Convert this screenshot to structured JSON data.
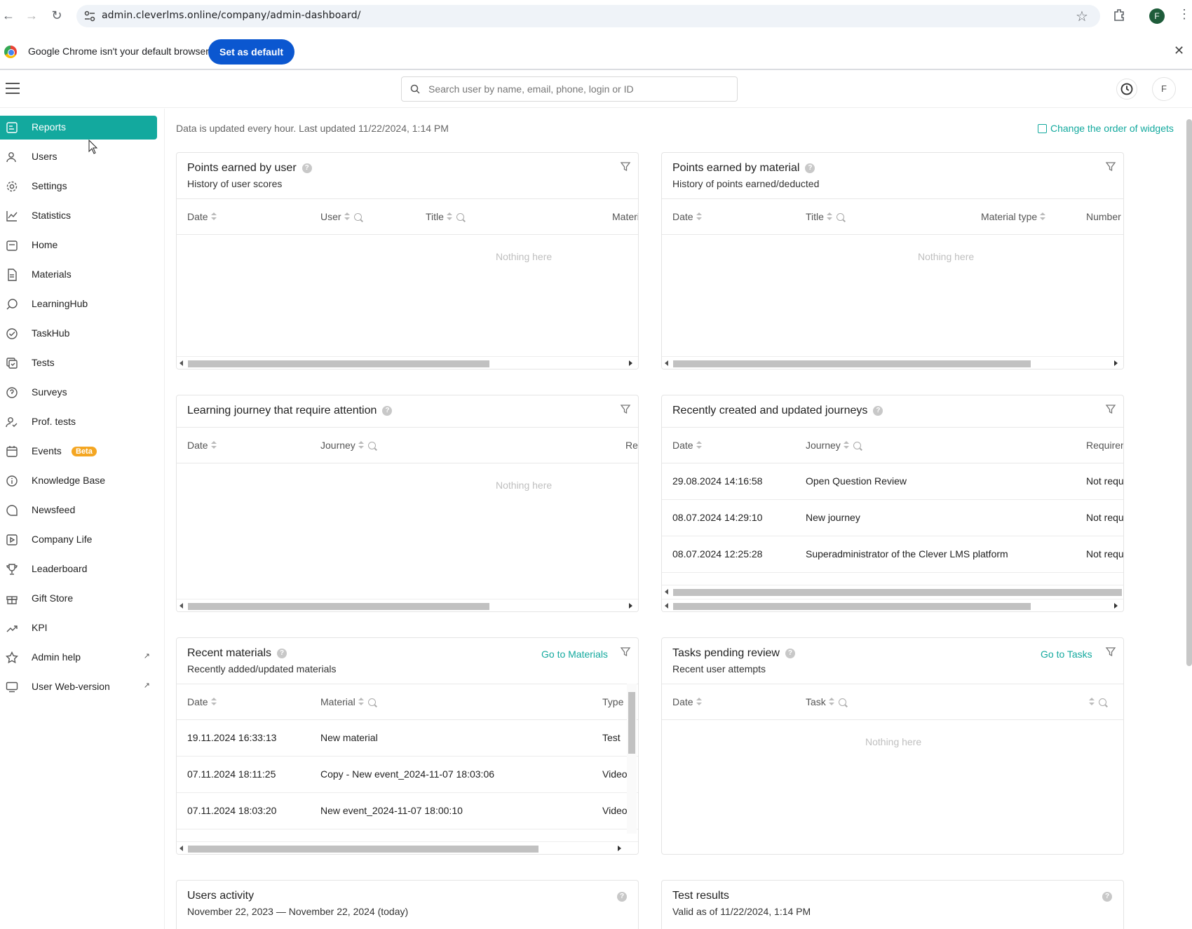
{
  "browser": {
    "url": "admin.cleverlms.online/company/admin-dashboard/",
    "profile_initial": "F",
    "default_msg": "Google Chrome isn't your default browser",
    "set_default_label": "Set as default"
  },
  "header": {
    "search_placeholder": "Search user by name, email, phone, login or ID",
    "avatar_initial": "F"
  },
  "sidebar": {
    "items": [
      {
        "label": "Reports",
        "icon": "reports-icon",
        "active": true
      },
      {
        "label": "Users",
        "icon": "users-icon"
      },
      {
        "label": "Settings",
        "icon": "gear-icon"
      },
      {
        "label": "Statistics",
        "icon": "chart-icon"
      },
      {
        "label": "Home",
        "icon": "home-icon"
      },
      {
        "label": "Materials",
        "icon": "document-icon"
      },
      {
        "label": "LearningHub",
        "icon": "learninghub-icon"
      },
      {
        "label": "TaskHub",
        "icon": "check-circle-icon"
      },
      {
        "label": "Tests",
        "icon": "tests-icon"
      },
      {
        "label": "Surveys",
        "icon": "survey-icon"
      },
      {
        "label": "Prof. tests",
        "icon": "prof-tests-icon"
      },
      {
        "label": "Events",
        "icon": "calendar-icon",
        "badge": "Beta"
      },
      {
        "label": "Knowledge Base",
        "icon": "info-icon"
      },
      {
        "label": "Newsfeed",
        "icon": "chat-icon"
      },
      {
        "label": "Company Life",
        "icon": "play-icon"
      },
      {
        "label": "Leaderboard",
        "icon": "trophy-icon"
      },
      {
        "label": "Gift Store",
        "icon": "gift-icon"
      },
      {
        "label": "KPI",
        "icon": "trend-icon"
      },
      {
        "label": "Admin help",
        "icon": "star-icon",
        "external": true
      },
      {
        "label": "User Web-version",
        "icon": "monitor-icon",
        "external": true
      }
    ],
    "accent": "#13a99e"
  },
  "main": {
    "update_note": "Data is updated every hour. Last updated 11/22/2024, 1:14 PM",
    "order_link": "Change the order of widgets",
    "widgets": {
      "points_user": {
        "title": "Points earned by user",
        "subtitle": "History of user scores",
        "columns": [
          "Date",
          "User",
          "Title",
          "Material"
        ],
        "empty": "Nothing here"
      },
      "points_material": {
        "title": "Points earned by material",
        "subtitle": "History of points earned/deducted",
        "columns": [
          "Date",
          "Title",
          "Material type",
          "Number"
        ],
        "empty": "Nothing here"
      },
      "journey_attention": {
        "title": "Learning journey that require attention",
        "columns": [
          "Date",
          "Journey",
          "Rev"
        ],
        "empty": "Nothing here"
      },
      "recent_journeys": {
        "title": "Recently created and updated journeys",
        "columns": [
          "Date",
          "Journey",
          "Requirem"
        ],
        "rows": [
          [
            "29.08.2024 14:16:58",
            "Open Question Review",
            "Not requ"
          ],
          [
            "08.07.2024 14:29:10",
            "New journey",
            "Not requ"
          ],
          [
            "08.07.2024 12:25:28",
            "Superadministrator of the Clever LMS platform",
            "Not requ"
          ]
        ]
      },
      "recent_materials": {
        "title": "Recent materials",
        "subtitle": "Recently added/updated materials",
        "link": "Go to Materials",
        "columns": [
          "Date",
          "Material",
          "Type"
        ],
        "rows": [
          [
            "19.11.2024 16:33:13",
            "New material",
            "Test"
          ],
          [
            "07.11.2024 18:11:25",
            "Copy - New event_2024-11-07 18:03:06",
            "Video"
          ],
          [
            "07.11.2024 18:03:20",
            "New event_2024-11-07 18:00:10",
            "Video"
          ]
        ]
      },
      "tasks_pending": {
        "title": "Tasks pending review",
        "subtitle": "Recent user attempts",
        "link": "Go to Tasks",
        "columns": [
          "Date",
          "Task"
        ],
        "empty": "Nothing here"
      },
      "users_activity": {
        "title": "Users activity",
        "subtitle": "November 22, 2023 — November 22, 2024 (today)"
      },
      "test_results": {
        "title": "Test results",
        "subtitle": "Valid as of 11/22/2024, 1:14 PM"
      }
    }
  }
}
